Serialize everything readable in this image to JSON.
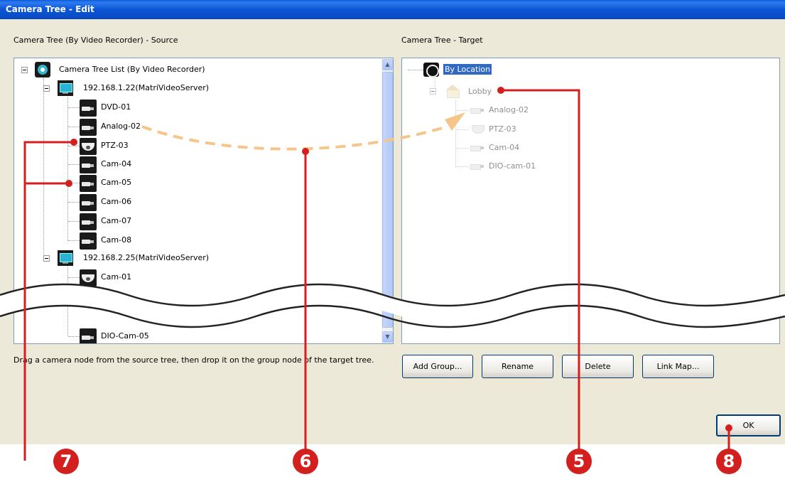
{
  "window": {
    "title": "Camera Tree - Edit"
  },
  "source": {
    "label": "Camera Tree (By Video Recorder) - Source",
    "root": "Camera Tree List (By Video Recorder)",
    "server1": "192.168.1.22(MatriVideoServer)",
    "server1_items": [
      "DVD-01",
      "Analog-02",
      "PTZ-03",
      "Cam-04",
      "Cam-05",
      "Cam-06",
      "Cam-07",
      "Cam-08"
    ],
    "server2": "192.168.2.25(MatriVideoServer)",
    "server2_items": [
      "Cam-01",
      "DIO-Cam-05"
    ]
  },
  "target": {
    "label": "Camera Tree - Target",
    "root": "By Location",
    "group": "Lobby",
    "items": [
      "Analog-02",
      "PTZ-03",
      "Cam-04",
      "DIO-cam-01"
    ]
  },
  "hint": "Drag a camera node from the source tree, then drop it on the group node of the target tree.",
  "buttons": {
    "add_group": "Add Group...",
    "rename": "Rename",
    "delete": "Delete",
    "link_map": "Link Map...",
    "ok": "OK"
  },
  "callouts": [
    "5",
    "6",
    "7",
    "8"
  ],
  "colors": {
    "callout": "#D41F1F",
    "drag_arrow": "#F5C58A",
    "title_bar": "#0A5BDB",
    "selection": "#316AC5"
  },
  "icons": [
    "recorder-tree-icon",
    "server-icon",
    "camera-icon",
    "ptz-camera-icon",
    "location-icon",
    "building-icon"
  ]
}
